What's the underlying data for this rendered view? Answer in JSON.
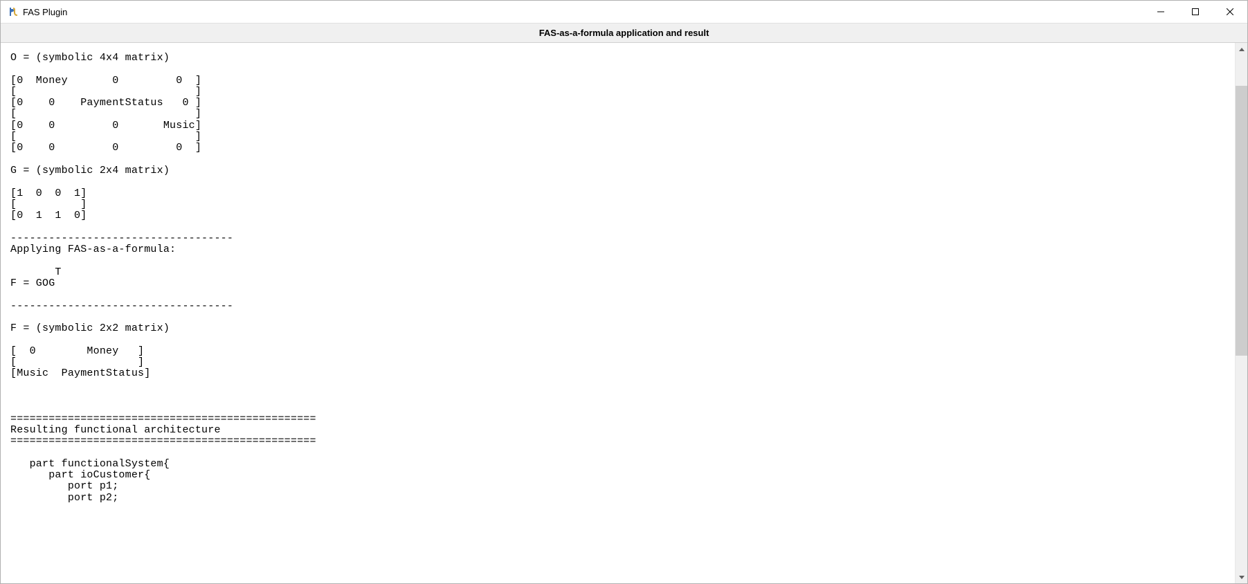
{
  "window": {
    "title": "FAS Plugin"
  },
  "header": {
    "title": "FAS-as-a-formula application and result"
  },
  "content": {
    "text": "O = (symbolic 4x4 matrix)\n\n[0  Money       0         0  ]\n[                            ]\n[0    0    PaymentStatus   0 ]\n[                            ]\n[0    0         0       Music]\n[                            ]\n[0    0         0         0  ]\n\nG = (symbolic 2x4 matrix)\n\n[1  0  0  1]\n[          ]\n[0  1  1  0]\n\n-----------------------------------\nApplying FAS-as-a-formula:\n\n       T\nF = GOG\n\n-----------------------------------\n\nF = (symbolic 2x2 matrix)\n\n[  0        Money   ]\n[                   ]\n[Music  PaymentStatus]\n\n\n\n================================================\nResulting functional architecture\n================================================\n\n   part functionalSystem{\n      part ioCustomer{\n         port p1;\n         port p2;"
  }
}
